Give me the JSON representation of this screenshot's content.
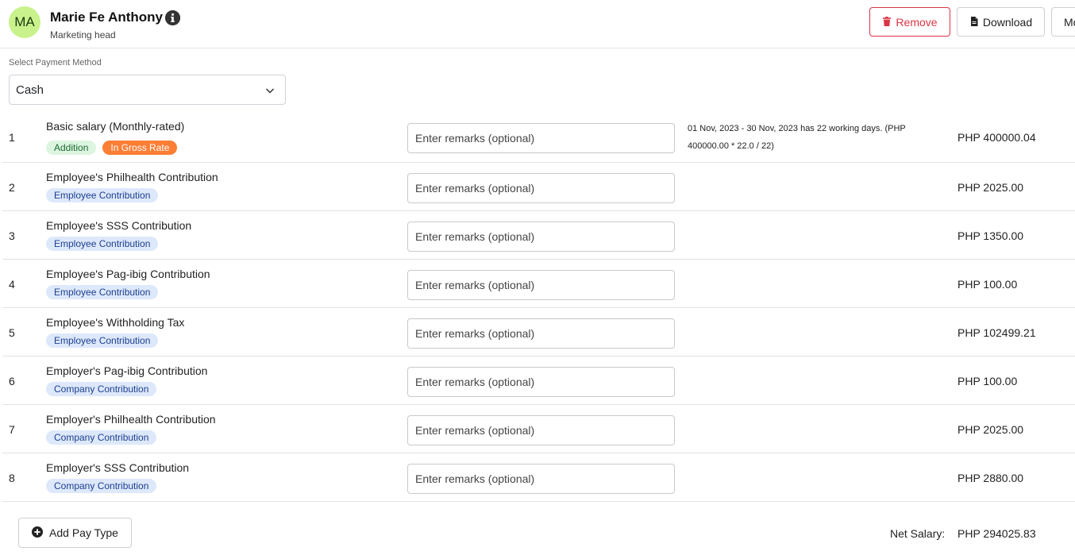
{
  "employee": {
    "initials": "MA",
    "name": "Marie Fe Anthony",
    "title": "Marketing head"
  },
  "actions": {
    "remove_label": "Remove",
    "download_label": "Download",
    "more_label": "Mo"
  },
  "payment_method": {
    "label": "Select Payment Method",
    "selected": "Cash"
  },
  "remarks_placeholder": "Enter remarks (optional)",
  "pay_items": [
    {
      "index": "1",
      "name": "Basic salary (Monthly-rated)",
      "tags": [
        "Addition",
        "In Gross Rate"
      ],
      "note": "01 Nov, 2023 - 30 Nov, 2023 has 22 working days. (PHP 400000.00 * 22.0 / 22)",
      "amount": "PHP 400000.04"
    },
    {
      "index": "2",
      "name": "Employee's Philhealth Contribution",
      "tags": [
        "Employee Contribution"
      ],
      "note": "",
      "amount": "PHP 2025.00"
    },
    {
      "index": "3",
      "name": "Employee's SSS Contribution",
      "tags": [
        "Employee Contribution"
      ],
      "note": "",
      "amount": "PHP 1350.00"
    },
    {
      "index": "4",
      "name": "Employee's Pag-ibig Contribution",
      "tags": [
        "Employee Contribution"
      ],
      "note": "",
      "amount": "PHP 100.00"
    },
    {
      "index": "5",
      "name": "Employee's Withholding Tax",
      "tags": [
        "Employee Contribution"
      ],
      "note": "",
      "amount": "PHP 102499.21"
    },
    {
      "index": "6",
      "name": "Employer's Pag-ibig Contribution",
      "tags": [
        "Company Contribution"
      ],
      "note": "",
      "amount": "PHP 100.00"
    },
    {
      "index": "7",
      "name": "Employer's Philhealth Contribution",
      "tags": [
        "Company Contribution"
      ],
      "note": "",
      "amount": "PHP 2025.00"
    },
    {
      "index": "8",
      "name": "Employer's SSS Contribution",
      "tags": [
        "Company Contribution"
      ],
      "note": "",
      "amount": "PHP 2880.00"
    }
  ],
  "footer": {
    "add_label": "Add Pay Type",
    "net_label": "Net Salary:",
    "net_value": "PHP 294025.83"
  }
}
